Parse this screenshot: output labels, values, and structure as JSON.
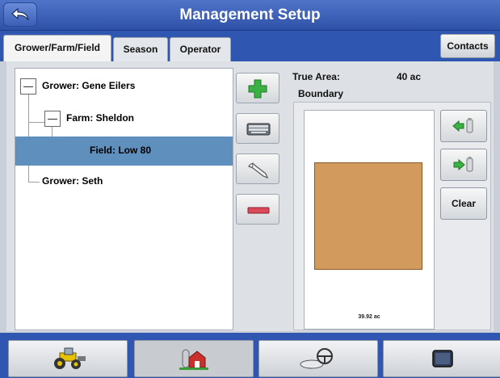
{
  "header": {
    "title": "Management Setup",
    "back_icon": "back-arrow-icon"
  },
  "tabs": [
    {
      "label": "Grower/Farm/Field",
      "active": true
    },
    {
      "label": "Season",
      "active": false
    },
    {
      "label": "Operator",
      "active": false
    }
  ],
  "contacts_label": "Contacts",
  "tree": {
    "items": [
      {
        "label": "Grower: Gene Eilers",
        "level": 0,
        "expanded": true
      },
      {
        "label": "Farm: Sheldon",
        "level": 1,
        "expanded": true
      },
      {
        "label": "Field: Low 80",
        "level": 2,
        "selected": true
      },
      {
        "label": "Grower: Seth",
        "level": 0
      }
    ]
  },
  "side_buttons": [
    {
      "name": "add-button",
      "icon": "plus-icon"
    },
    {
      "name": "keyboard-button",
      "icon": "keyboard-icon"
    },
    {
      "name": "wrench-button",
      "icon": "wrench-icon"
    },
    {
      "name": "remove-button",
      "icon": "minus-icon"
    }
  ],
  "info": {
    "true_area_label": "True Area:",
    "true_area_value": "40 ac",
    "boundary_label": "Boundary"
  },
  "boundary": {
    "map_area_label": "39.92 ac",
    "field_color": "#d39a5e",
    "import_icon": "import-boundary-icon",
    "export_icon": "export-boundary-icon",
    "clear_label": "Clear"
  },
  "bottom_nav": [
    {
      "name": "equipment-nav",
      "icon": "tractor-icon",
      "active": false
    },
    {
      "name": "management-nav",
      "icon": "farm-barn-icon",
      "active": true
    },
    {
      "name": "guidance-nav",
      "icon": "steering-wheel-icon",
      "active": false
    },
    {
      "name": "display-nav",
      "icon": "display-screen-icon",
      "active": false
    }
  ],
  "colors": {
    "header": "#2f56b0",
    "selected_row": "#5f8fbd",
    "accent_green": "#3cb043",
    "accent_red": "#d94a5a"
  }
}
